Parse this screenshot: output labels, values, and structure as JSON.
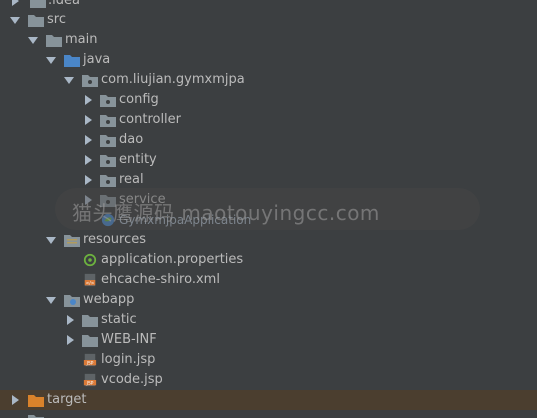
{
  "tree": {
    "idea": ".idea",
    "src": "src",
    "main": "main",
    "java": "java",
    "package": "com.liujian.gymxmjpa",
    "config": "config",
    "controller": "controller",
    "dao": "dao",
    "entity": "entity",
    "real": "real",
    "service": "service",
    "app_class": "GymxmjpaApplication",
    "resources": "resources",
    "app_props": "application.properties",
    "ehcache": "ehcache-shiro.xml",
    "webapp": "webapp",
    "static": "static",
    "webinf": "WEB-INF",
    "login": "login.jsp",
    "vcode": "vcode.jsp",
    "target": "target"
  },
  "watermark": {
    "text": "猫头鹰源码 maotouyingcc.com"
  },
  "colors": {
    "background": "#3c3f41",
    "folder": "#87939a",
    "source_folder": "#4a86c8",
    "package_folder": "#87939a",
    "resource_folder": "#b19b5e",
    "target_folder": "#d9822b",
    "jsp_icon": "#d97a38",
    "xml_icon": "#d97a38"
  }
}
